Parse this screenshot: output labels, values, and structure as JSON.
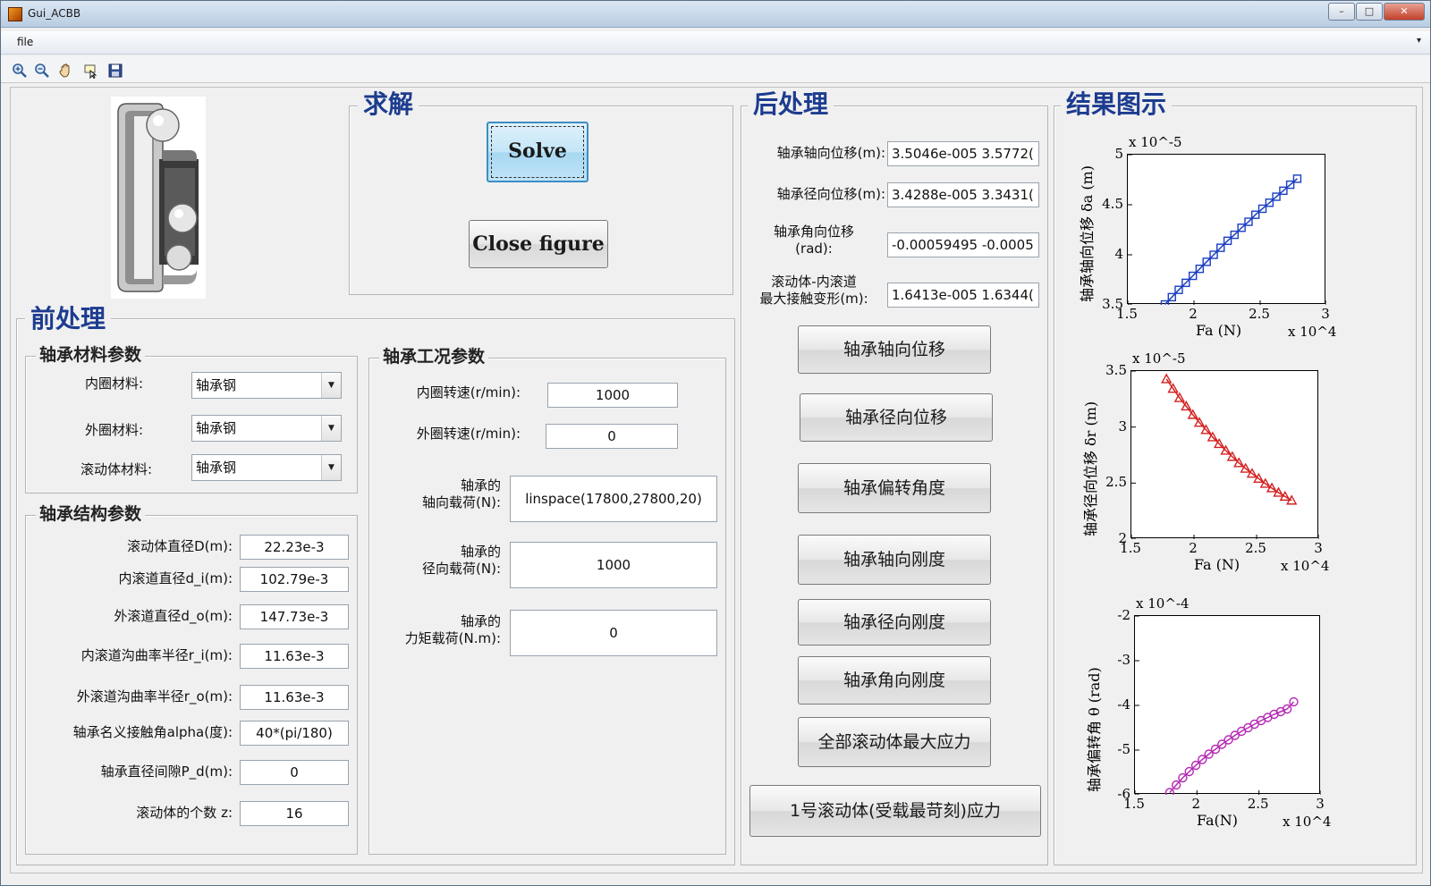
{
  "window": {
    "title": "Gui_ACBB",
    "btn_minimize": "–",
    "btn_maximize": "□",
    "btn_close": "✕"
  },
  "menu": {
    "file": "file",
    "overflow": "▾"
  },
  "toolbar": {
    "icons": [
      "zoom-in-icon",
      "zoom-out-icon",
      "pan-icon",
      "data-cursor-icon",
      "save-icon"
    ]
  },
  "solve_panel": {
    "title": "求解",
    "solve_label": "Solve",
    "close_label": "Close figure"
  },
  "pre_panel": {
    "title": "前处理",
    "material": {
      "title": "轴承材料参数",
      "inner_label": "内圈材料:",
      "inner_value": "轴承钢",
      "outer_label": "外圈材料:",
      "outer_value": "轴承钢",
      "roller_label": "滚动体材料:",
      "roller_value": "轴承钢"
    },
    "structure": {
      "title": "轴承结构参数",
      "fields": [
        {
          "label": "滚动体直径D(m):",
          "value": "22.23e-3"
        },
        {
          "label": "内滚道直径d_i(m):",
          "value": "102.79e-3"
        },
        {
          "label": "外滚道直径d_o(m):",
          "value": "147.73e-3"
        },
        {
          "label": "内滚道沟曲率半径r_i(m):",
          "value": "11.63e-3"
        },
        {
          "label": "外滚道沟曲率半径r_o(m):",
          "value": "11.63e-3"
        },
        {
          "label": "轴承名义接触角alpha(度):",
          "value": "40*(pi/180)"
        },
        {
          "label": "轴承直径间隙P_d(m):",
          "value": "0"
        },
        {
          "label": "滚动体的个数 z:",
          "value": "16"
        }
      ]
    },
    "operating": {
      "title": "轴承工况参数",
      "inner_speed_label": "内圈转速(r/min):",
      "inner_speed": "1000",
      "outer_speed_label": "外圈转速(r/min):",
      "outer_speed": "0",
      "axial_label": "轴承的\n轴向载荷(N):",
      "axial": "linspace(17800,27800,20)",
      "radial_label": "轴承的\n径向载荷(N):",
      "radial": "1000",
      "moment_label": "轴承的\n力矩载荷(N.m):",
      "moment": "0"
    }
  },
  "post_panel": {
    "title": "后处理",
    "fields": [
      {
        "label": "轴承轴向位移(m):",
        "value": "3.5046e-005 3.5772("
      },
      {
        "label": "轴承径向位移(m):",
        "value": "3.4288e-005 3.3431("
      },
      {
        "label": "轴承角向位移\n(rad):",
        "value": "-0.00059495 -0.0005"
      },
      {
        "label": "滚动体-内滚道\n最大接触变形(m):",
        "value": "1.6413e-005 1.6344("
      }
    ],
    "buttons": [
      "轴承轴向位移",
      "轴承径向位移",
      "轴承偏转角度",
      "轴承轴向刚度",
      "轴承径向刚度",
      "轴承角向刚度",
      "全部滚动体最大应力",
      "1号滚动体(受载最苛刻)应力"
    ]
  },
  "results_panel": {
    "title": "结果图示"
  },
  "chart_data": [
    {
      "type": "scatter",
      "ylabel": "轴承轴向位移 δa (m)",
      "xlabel": "Fa (N)",
      "x_multiplier": "x 10^4",
      "y_multiplier": "x 10^-5",
      "xlim": [
        1.5,
        3
      ],
      "ylim": [
        3.5,
        5
      ],
      "xticks": [
        "1.5",
        "2",
        "2.5",
        "3"
      ],
      "yticks": [
        "3.5",
        "4",
        "4.5",
        "5"
      ],
      "marker": "square",
      "color": "#1a3ec2",
      "x": [
        1.78,
        1.833,
        1.885,
        1.938,
        1.991,
        2.043,
        2.096,
        2.149,
        2.201,
        2.254,
        2.306,
        2.359,
        2.412,
        2.464,
        2.517,
        2.57,
        2.622,
        2.675,
        2.727,
        2.78
      ],
      "y": [
        3.5046,
        3.5772,
        3.65,
        3.72,
        3.79,
        3.86,
        3.93,
        4.0,
        4.07,
        4.14,
        4.2,
        4.27,
        4.33,
        4.4,
        4.46,
        4.52,
        4.58,
        4.64,
        4.7,
        4.76
      ]
    },
    {
      "type": "scatter",
      "ylabel": "轴承径向位移 δr (m)",
      "xlabel": "Fa (N)",
      "x_multiplier": "x 10^4",
      "y_multiplier": "x 10^-5",
      "xlim": [
        1.5,
        3
      ],
      "ylim": [
        2,
        3.5
      ],
      "xticks": [
        "1.5",
        "2",
        "2.5",
        "3"
      ],
      "yticks": [
        "2",
        "2.5",
        "3",
        "3.5"
      ],
      "marker": "triangle",
      "color": "#d42020",
      "x": [
        1.78,
        1.833,
        1.885,
        1.938,
        1.991,
        2.043,
        2.096,
        2.149,
        2.201,
        2.254,
        2.306,
        2.359,
        2.412,
        2.464,
        2.517,
        2.57,
        2.622,
        2.675,
        2.727,
        2.78
      ],
      "y": [
        3.4288,
        3.3431,
        3.26,
        3.185,
        3.11,
        3.04,
        2.975,
        2.91,
        2.85,
        2.79,
        2.735,
        2.68,
        2.63,
        2.585,
        2.54,
        2.495,
        2.455,
        2.415,
        2.38,
        2.345
      ]
    },
    {
      "type": "scatter",
      "ylabel": "轴承偏转角 θ (rad)",
      "xlabel": "Fa(N)",
      "x_multiplier": "x 10^4",
      "y_multiplier": "x 10^-4",
      "xlim": [
        1.5,
        3
      ],
      "ylim": [
        -6,
        -2
      ],
      "xticks": [
        "1.5",
        "2",
        "2.5",
        "3"
      ],
      "yticks": [
        "-2",
        "-3",
        "-4",
        "-5",
        "-6"
      ],
      "marker": "circle",
      "color": "#b42bb4",
      "x": [
        1.78,
        1.833,
        1.885,
        1.938,
        1.991,
        2.043,
        2.096,
        2.149,
        2.201,
        2.254,
        2.306,
        2.359,
        2.412,
        2.464,
        2.517,
        2.57,
        2.622,
        2.675,
        2.727,
        2.78
      ],
      "y": [
        -5.95,
        -5.78,
        -5.62,
        -5.48,
        -5.34,
        -5.21,
        -5.09,
        -4.98,
        -4.87,
        -4.77,
        -4.67,
        -4.58,
        -4.5,
        -4.42,
        -4.34,
        -4.27,
        -4.2,
        -4.14,
        -4.08,
        -3.92
      ]
    }
  ]
}
